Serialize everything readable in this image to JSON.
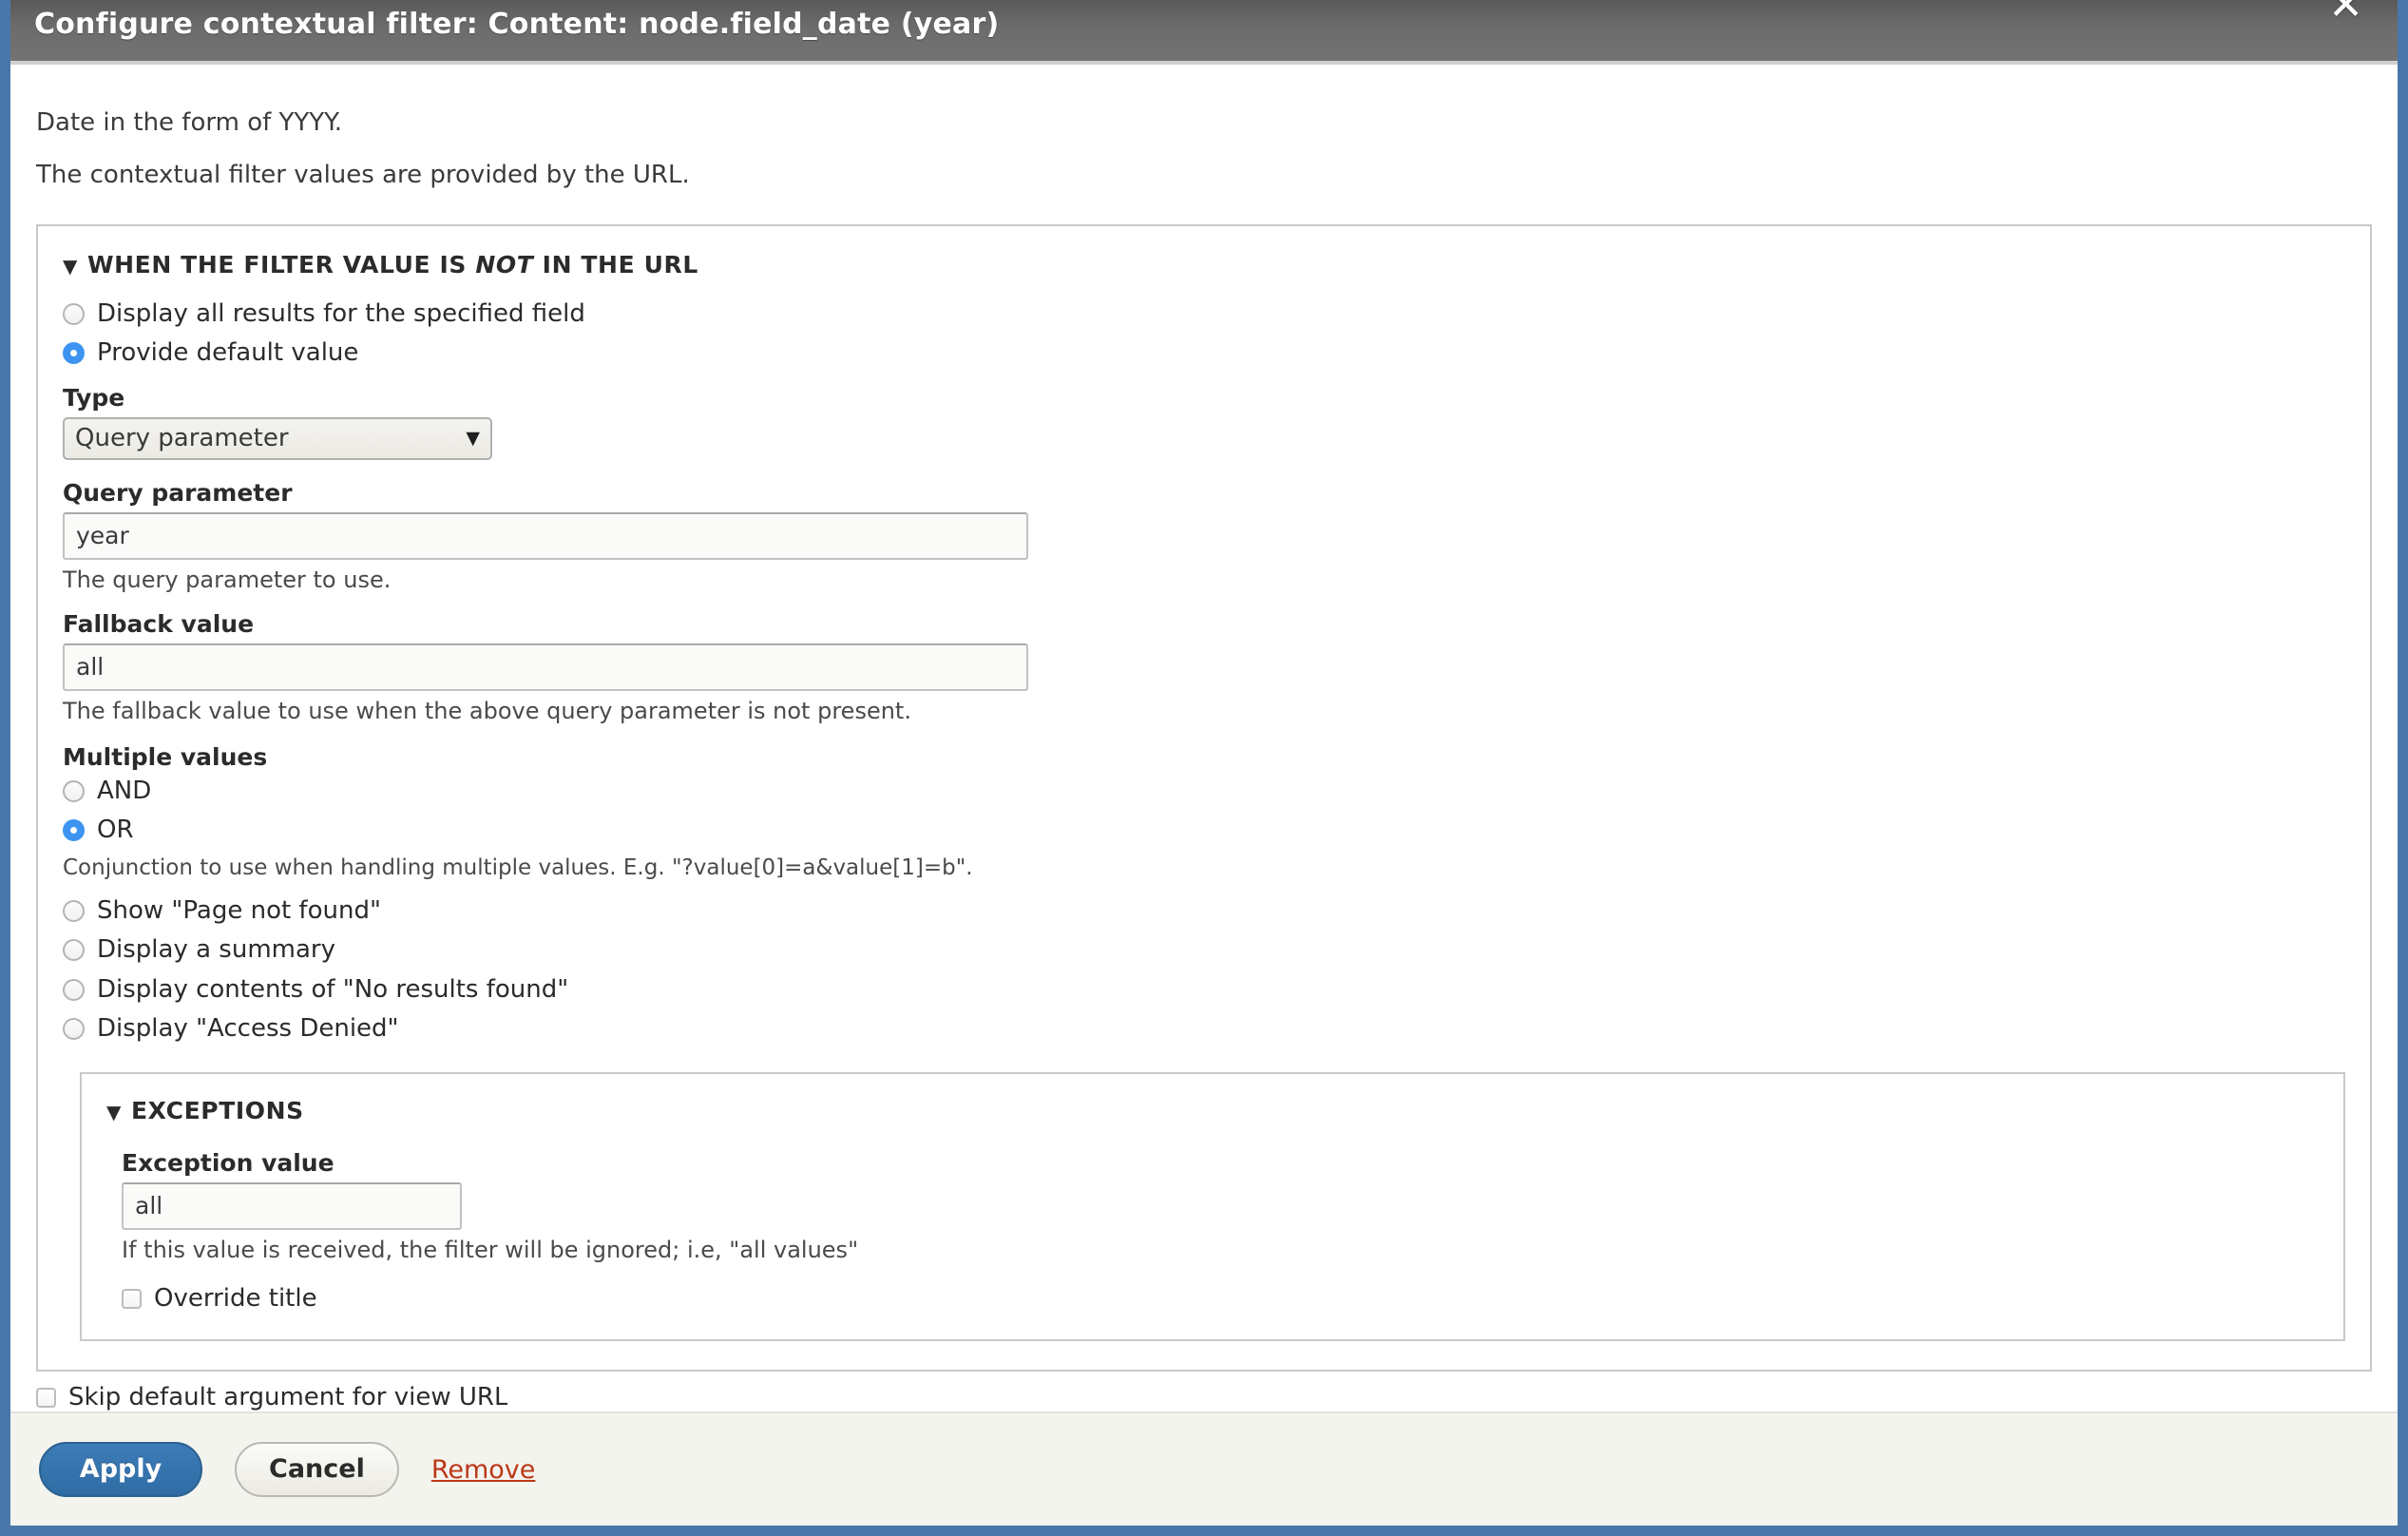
{
  "dialog": {
    "title": "Configure contextual filter: Content: node.field_date (year)",
    "close_icon": "close-icon",
    "intro_1": "Date in the form of YYYY.",
    "intro_2": "The contextual filter values are provided by the URL."
  },
  "main_panel": {
    "legend_arrow": "▼",
    "legend_prefix": "WHEN THE FILTER VALUE IS ",
    "legend_emphasis": "NOT",
    "legend_suffix": " IN THE URL",
    "options": [
      {
        "label": "Display all results for the specified field",
        "checked": false
      },
      {
        "label": "Provide default value",
        "checked": true
      }
    ],
    "type_field": {
      "label": "Type",
      "value": "Query parameter",
      "arrow_icon": "chevron-down-icon"
    },
    "query_parameter_field": {
      "label": "Query parameter",
      "value": "year",
      "help": "The query parameter to use."
    },
    "fallback_field": {
      "label": "Fallback value",
      "value": "all",
      "help": "The fallback value to use when the above query parameter is not present."
    },
    "multiple_values": {
      "label": "Multiple values",
      "options": [
        {
          "label": "AND",
          "checked": false
        },
        {
          "label": "OR",
          "checked": true
        }
      ],
      "help": "Conjunction to use when handling multiple values. E.g. \"?value[0]=a&value[1]=b\"."
    },
    "options_tail": [
      {
        "label": "Show \"Page not found\"",
        "checked": false
      },
      {
        "label": "Display a summary",
        "checked": false
      },
      {
        "label": "Display contents of \"No results found\"",
        "checked": false
      },
      {
        "label": "Display \"Access Denied\"",
        "checked": false
      }
    ]
  },
  "exceptions_panel": {
    "legend_arrow": "▼",
    "legend": "EXCEPTIONS",
    "exception_value_field": {
      "label": "Exception value",
      "value": "all",
      "help": "If this value is received, the filter will be ignored; i.e, \"all values\""
    },
    "override_title": {
      "label": "Override title",
      "checked": false
    }
  },
  "skip_default": {
    "label": "Skip default argument for view URL",
    "checked": false
  },
  "footer": {
    "apply_label": "Apply",
    "cancel_label": "Cancel",
    "remove_label": "Remove"
  },
  "colors": {
    "accent_blue": "#3d94f0",
    "primary_button": "#2f6ca5",
    "frame_border": "#4a77ab",
    "remove_link": "#bb3817",
    "titlebar": "#6c6c6c"
  }
}
